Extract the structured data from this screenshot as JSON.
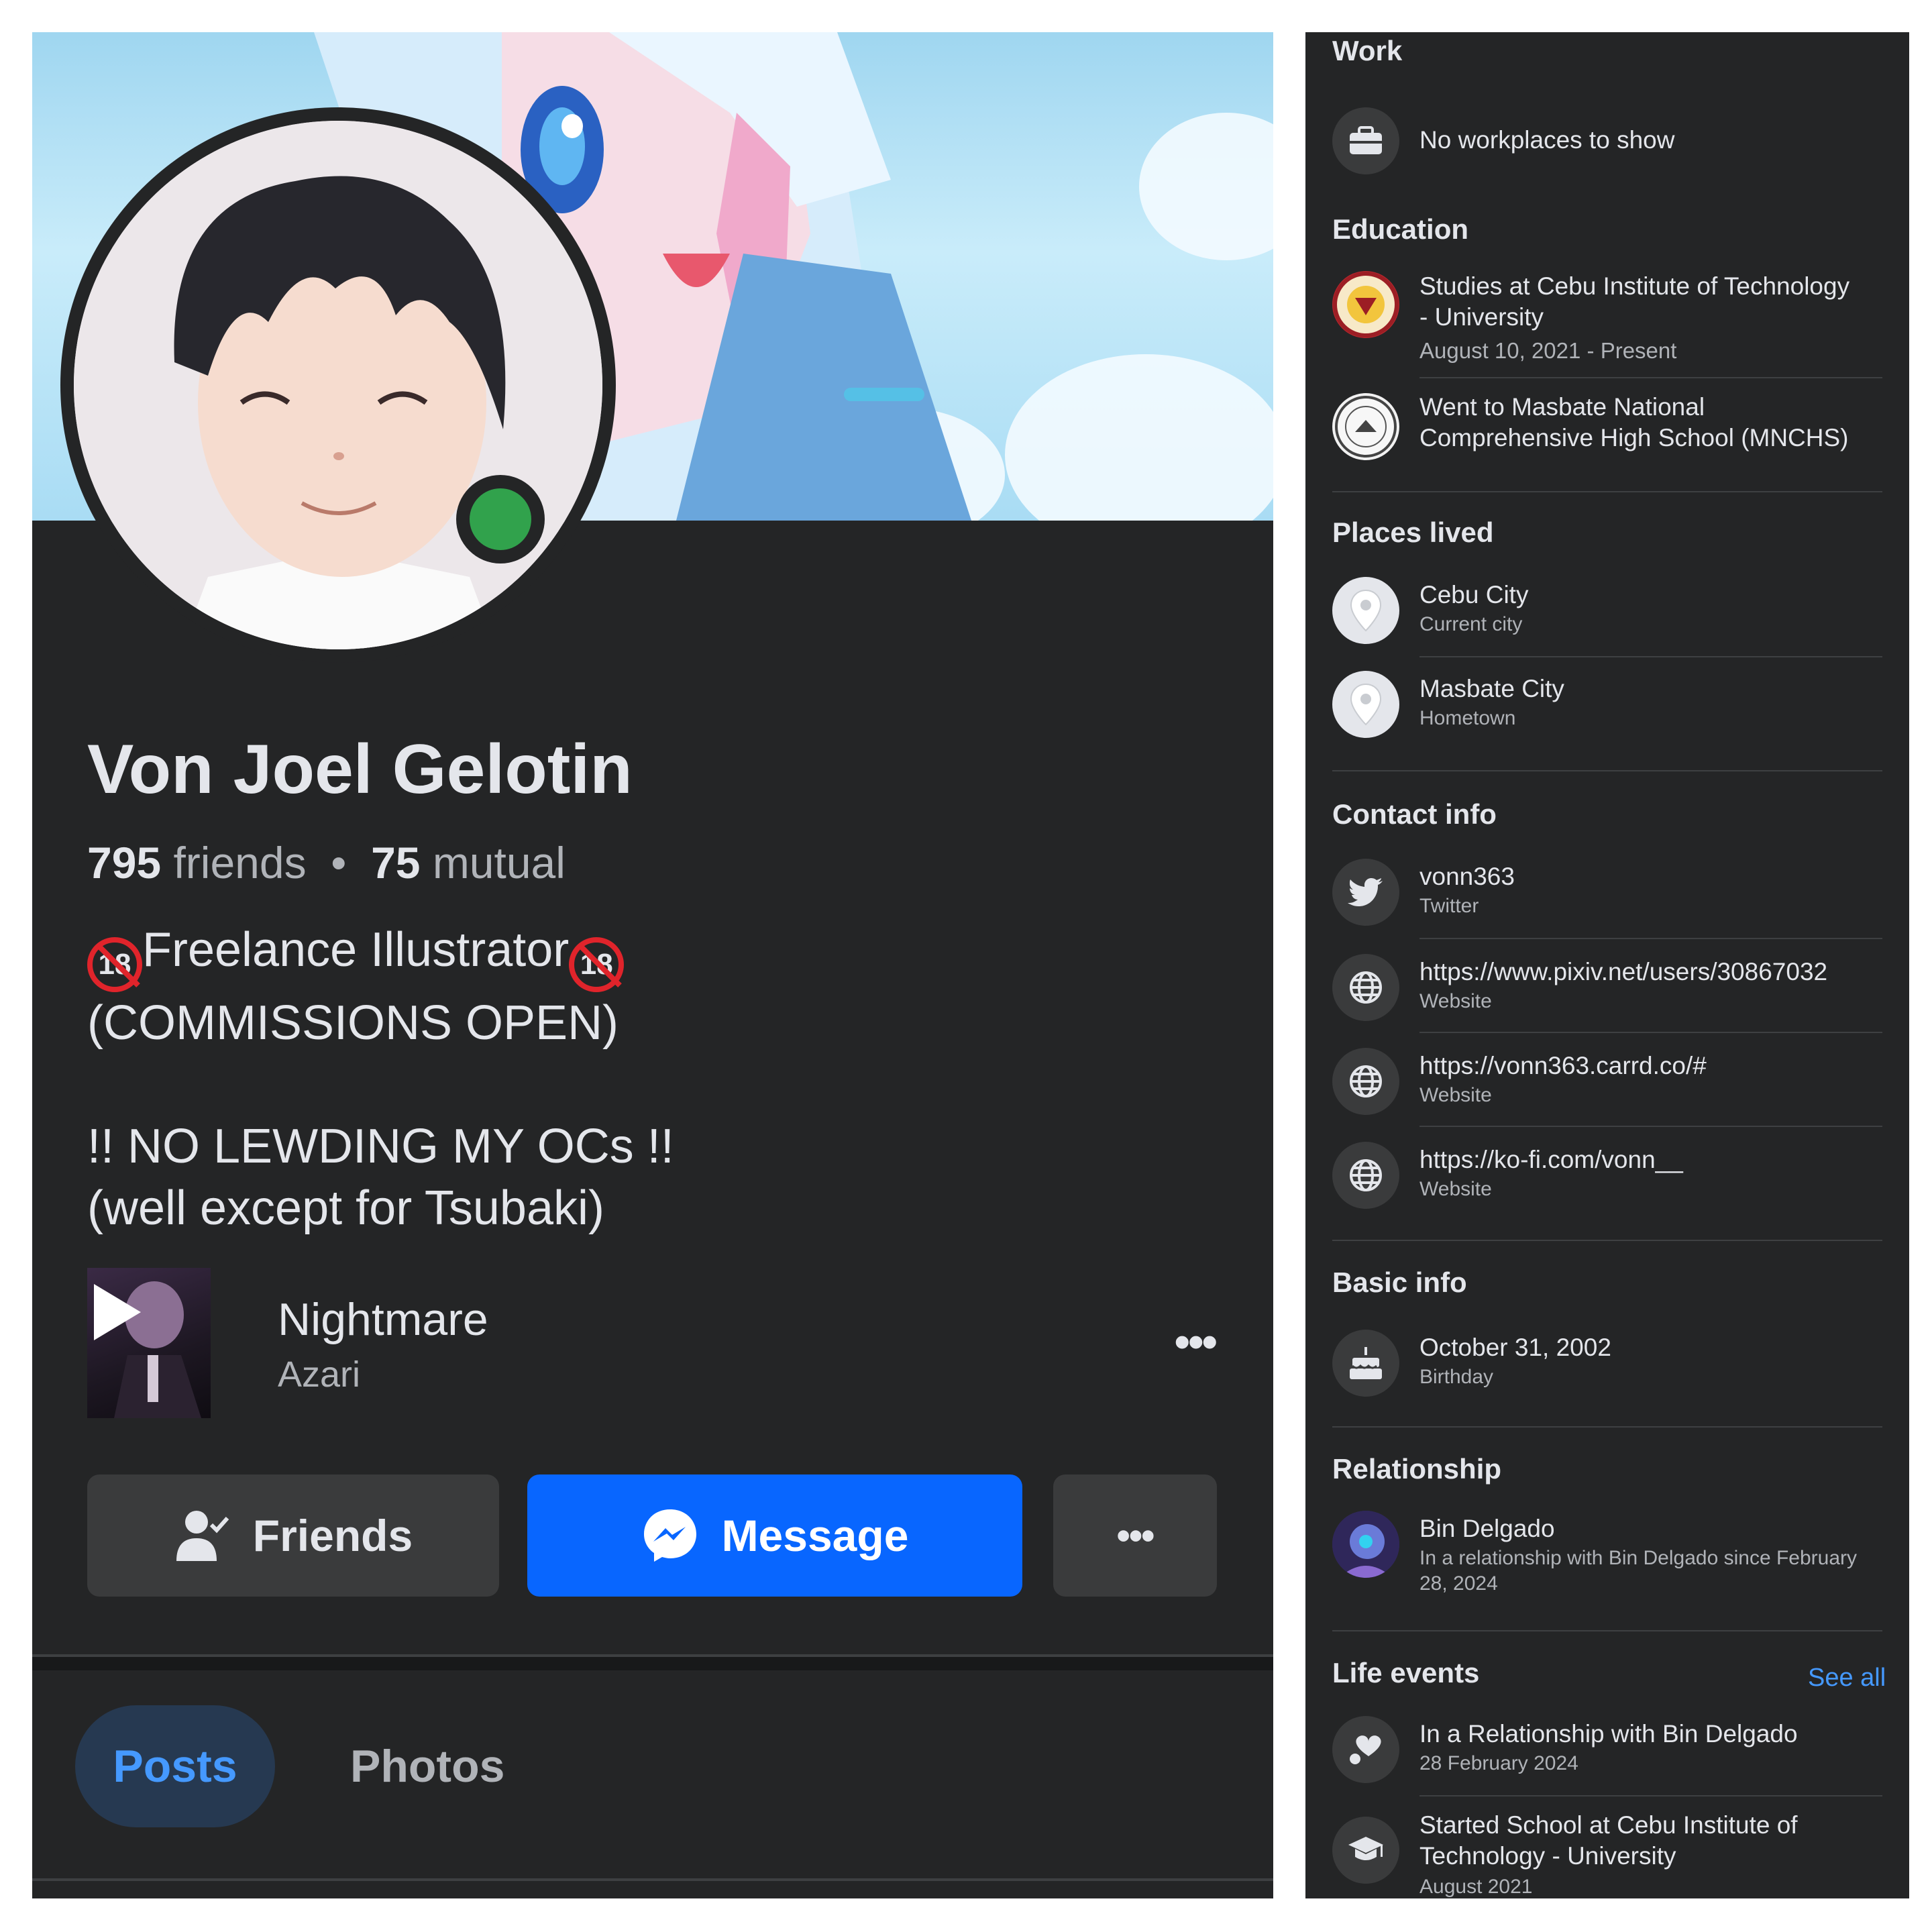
{
  "profile": {
    "name": "Von Joel Gelotin",
    "friends_count": "795",
    "friends_label": "friends",
    "separator": "•",
    "mutual_count": "75",
    "mutual_label": "mutual",
    "bio_line1_badge": "18",
    "bio_line1_text": "Freelance Illustrator",
    "bio_line2": "(COMMISSIONS OPEN)",
    "bio_line3": "!! NO LEWDING MY OCs !!",
    "bio_line4": "(well except for Tsubaki)",
    "online_color": "#31a24c"
  },
  "music": {
    "title": "Nightmare",
    "artist": "Azari",
    "more": "•••"
  },
  "actions": {
    "friends": "Friends",
    "message": "Message",
    "more": "•••",
    "accent": "#0866ff"
  },
  "tabs": [
    {
      "label": "Posts",
      "active": true
    },
    {
      "label": "Photos",
      "active": false
    }
  ],
  "about": {
    "work": {
      "title": "Work",
      "items": [
        {
          "icon": "briefcase-icon",
          "text": "No workplaces to show"
        }
      ]
    },
    "education": {
      "title": "Education",
      "items": [
        {
          "icon": "school-logo-citu",
          "line1": "Studies at Cebu Institute of Technology",
          "line2": "- University",
          "sub": "August 10, 2021 - Present"
        },
        {
          "icon": "school-logo-mnchs",
          "line1": "Went to Masbate National",
          "line2": "Comprehensive High School (MNCHS)"
        }
      ]
    },
    "places": {
      "title": "Places lived",
      "items": [
        {
          "icon": "location-pin-icon",
          "text": "Cebu City",
          "sub": "Current city"
        },
        {
          "icon": "location-pin-icon",
          "text": "Masbate City",
          "sub": "Hometown"
        }
      ]
    },
    "contact": {
      "title": "Contact info",
      "items": [
        {
          "icon": "twitter-icon",
          "text": "vonn363",
          "sub": "Twitter"
        },
        {
          "icon": "globe-icon",
          "text": "https://www.pixiv.net/users/30867032",
          "sub": "Website"
        },
        {
          "icon": "globe-icon",
          "text": "https://vonn363.carrd.co/#",
          "sub": "Website"
        },
        {
          "icon": "globe-icon",
          "text": "https://ko-fi.com/vonn__",
          "sub": "Website"
        }
      ]
    },
    "basic": {
      "title": "Basic info",
      "items": [
        {
          "icon": "birthday-cake-icon",
          "text": "October 31, 2002",
          "sub": "Birthday"
        }
      ]
    },
    "relationship": {
      "title": "Relationship",
      "items": [
        {
          "icon": "partner-avatar",
          "text": "Bin Delgado",
          "sub_line1": "In a relationship with Bin Delgado since February",
          "sub_line2": "28, 2024"
        }
      ]
    },
    "life_events": {
      "title": "Life events",
      "see_all": "See all",
      "items": [
        {
          "icon": "heart-event-icon",
          "line1": "In a Relationship with Bin Delgado",
          "sub": "28 February 2024"
        },
        {
          "icon": "graduation-cap-icon",
          "line1": "Started School at Cebu Institute of",
          "line2": "Technology - University",
          "sub": "August 2021"
        }
      ]
    }
  }
}
